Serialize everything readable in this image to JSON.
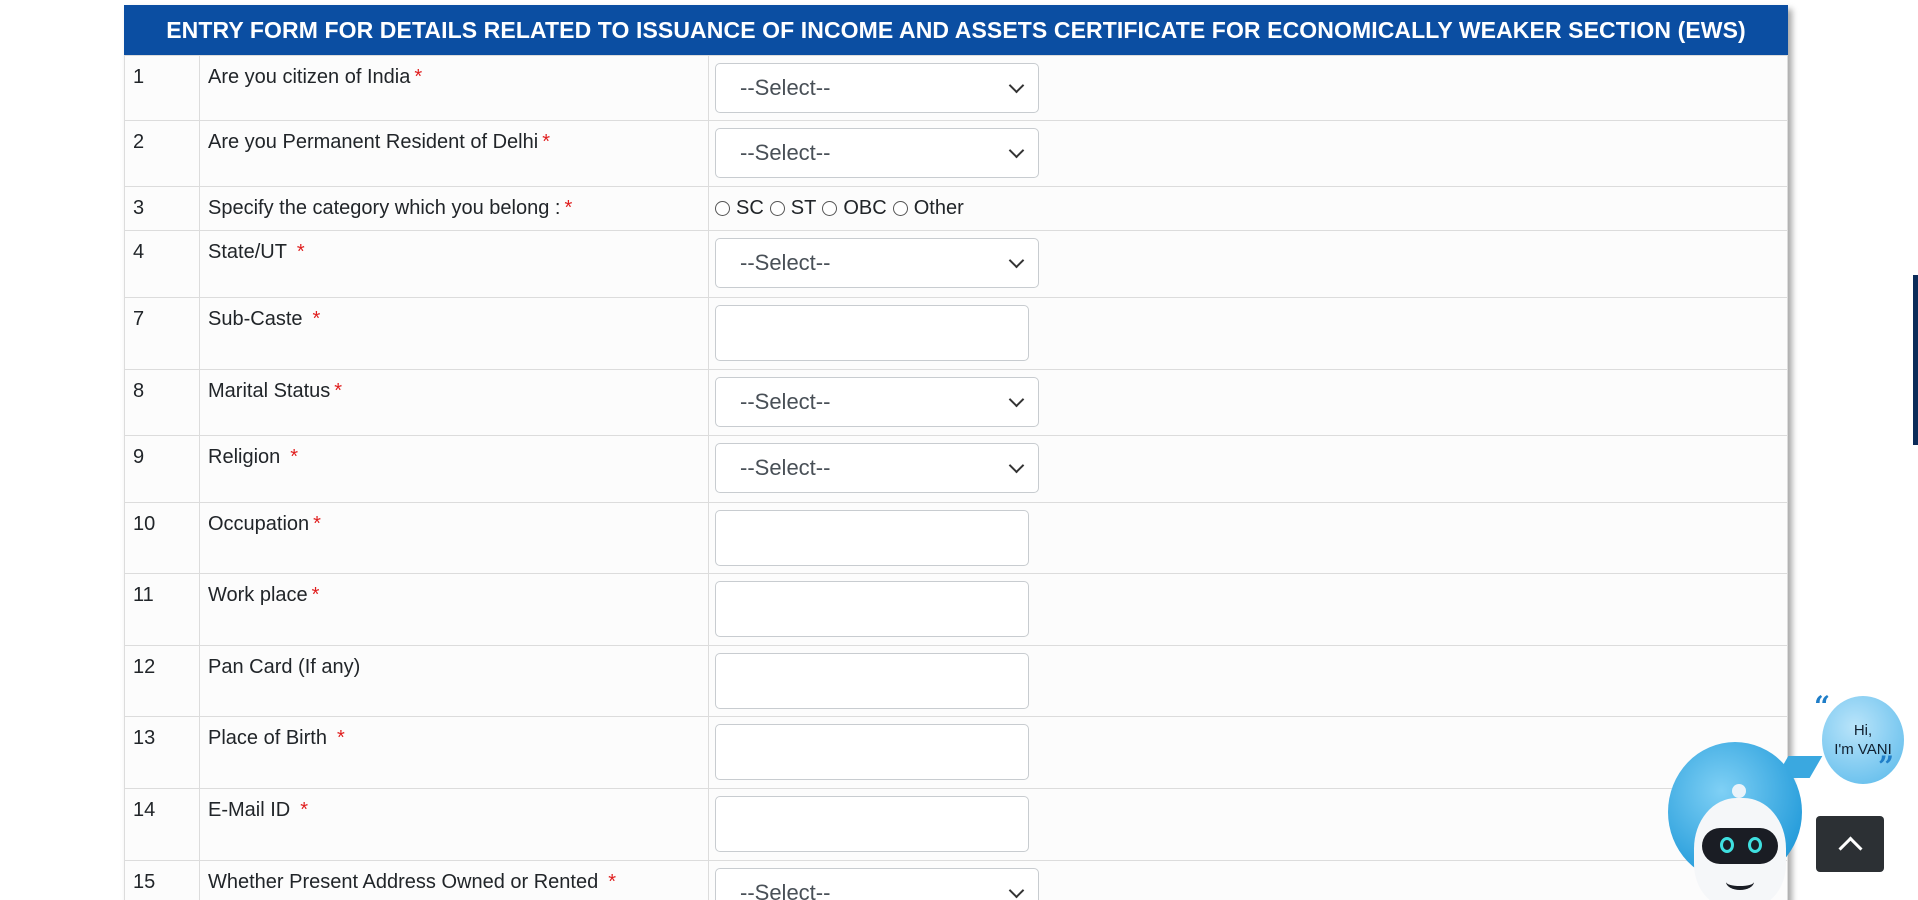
{
  "form": {
    "header": "ENTRY FORM FOR DETAILS RELATED TO ISSUANCE OF INCOME AND ASSETS CERTIFICATE FOR ECONOMICALLY WEAKER SECTION (EWS)",
    "required_marker": "*",
    "select_placeholder": "--Select--",
    "rows": [
      {
        "num": "1",
        "label": "Are you citizen of India",
        "type": "select"
      },
      {
        "num": "2",
        "label": "Are you Permanent Resident of Delhi",
        "type": "select"
      },
      {
        "num": "3",
        "label": "Specify the category which you belong :",
        "type": "radio",
        "options": [
          "SC",
          "ST",
          "OBC",
          "Other"
        ]
      },
      {
        "num": "4",
        "label": "State/UT",
        "type": "select"
      },
      {
        "num": "7",
        "label": "Sub-Caste",
        "type": "text"
      },
      {
        "num": "8",
        "label": "Marital Status",
        "type": "select"
      },
      {
        "num": "9",
        "label": "Religion",
        "type": "select"
      },
      {
        "num": "10",
        "label": "Occupation",
        "type": "text"
      },
      {
        "num": "11",
        "label": "Work place",
        "type": "text"
      },
      {
        "num": "12",
        "label": "Pan Card (If any)",
        "type": "text"
      },
      {
        "num": "13",
        "label": "Place of Birth",
        "type": "text"
      },
      {
        "num": "14",
        "label": "E-Mail ID",
        "type": "text"
      },
      {
        "num": "15",
        "label": "Whether Present Address Owned or Rented",
        "type": "select"
      }
    ]
  },
  "chatbot": {
    "greeting_line1": "Hi,",
    "greeting_line2": "I'm VANI"
  },
  "colors": {
    "header_bg": "#0b4ea2",
    "required": "#e01e1e",
    "scroll_top_bg": "#2c3034"
  }
}
